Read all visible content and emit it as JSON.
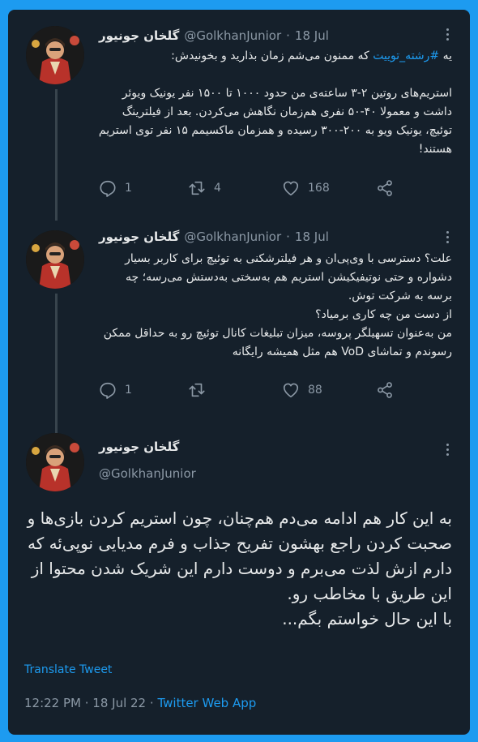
{
  "tweets": [
    {
      "display_name": "گلخان جونیور",
      "handle": "@GolkhanJunior",
      "dot": "·",
      "date": "18 Jul",
      "text_prefix": "یه ",
      "hashtag": "#رشته_توییت",
      "text_rest": " که ممنون می‌شم زمان بذارید و بخونیدش:\n\nاستریم‌های روتین ۲-۳ ساعته‌ی من حدود ۱۰۰۰ تا ۱۵۰۰ نفر یونیک ویوئر داشت و معمولا ۴۰-۵۰ نفری هم‌زمان نگاهش می‌کردن. بعد از فیلترینگ توئیچ، یونیک ویو به ۲۰۰-۳۰۰ رسیده و همزمان ماکسیمم ۱۵ نفر توی استریم هستند!",
      "replies": "1",
      "retweets": "4",
      "likes": "168"
    },
    {
      "display_name": "گلخان جونیور",
      "handle": "@GolkhanJunior",
      "dot": "·",
      "date": "18 Jul",
      "text": "علت؟ دسترسی با وی‌پی‌ان و هر فیلترشکنی به توئیچ برای کاربر بسیار دشواره و حتی نوتیفیکیشن استریم هم به‌سختی به‌دستش می‌رسه؛ چه برسه به شرکت توش.\nاز دست من چه کاری برمیاد؟\nمن به‌عنوان تسهیلگر پروسه، میزان تبلیغات کانال توئیچ رو به حداقل ممکن رسوندم و تماشای VoD هم مثل همیشه رایگانه",
      "replies": "1",
      "retweets": "",
      "likes": "88"
    }
  ],
  "main_tweet": {
    "display_name": "گلخان جونیور",
    "handle": "@GolkhanJunior",
    "text": "به این کار هم ادامه می‌دم هم‌چنان، چون استریم کردن بازی‌ها و صحبت کردن راجع بهشون تفریح جذاب و فرم مدیایی نوپی‌ئه که دارم ازش لذت می‌برم و دوست دارم این شریک شدن محتوا از این طریق با مخاطب رو.\nبا این حال خواستم بگم...",
    "translate_label": "Translate Tweet",
    "timestamp": "12:22 PM · 18 Jul 22",
    "dot": "·",
    "source": "Twitter Web App"
  },
  "colors": {
    "frame_border": "#1d9bf0",
    "background": "#15202b",
    "text_primary": "#e7e9ea",
    "text_secondary": "#8b98a5",
    "link": "#1d9bf0"
  },
  "icons": [
    "reply-icon",
    "retweet-icon",
    "heart-icon",
    "share-icon",
    "more-options-icon"
  ]
}
